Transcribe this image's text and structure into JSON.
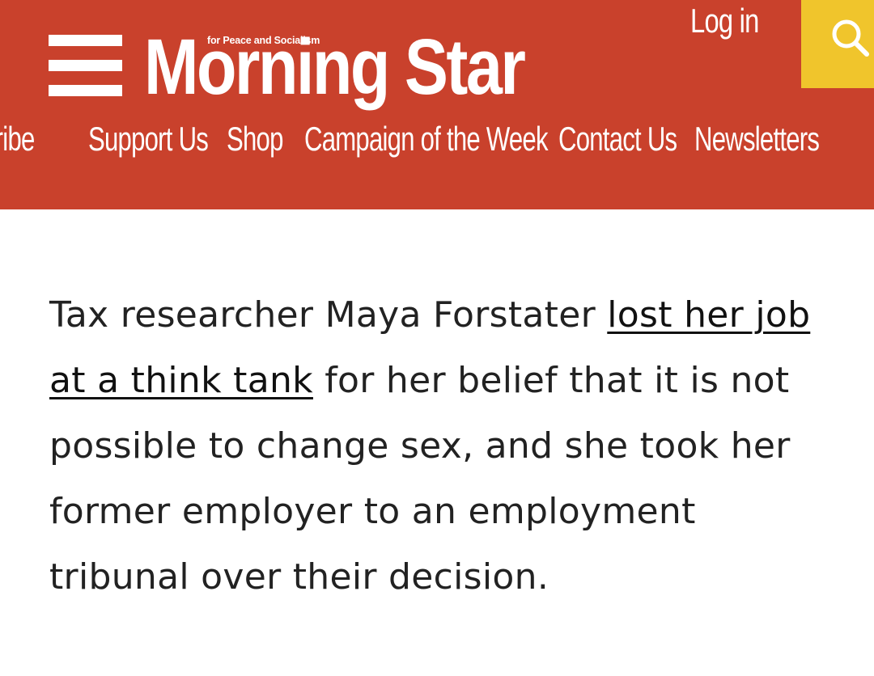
{
  "header": {
    "logo": {
      "tagline": "for Peace and Socialism",
      "name": "Morning Star"
    },
    "login_label": "Log in",
    "colors": {
      "background": "#c9412c",
      "search_background": "#f0c52c",
      "text": "#ffffff"
    },
    "icons": {
      "menu": "hamburger-menu-icon",
      "search": "search-icon"
    }
  },
  "nav": {
    "items": [
      {
        "label": "Subscribe"
      },
      {
        "label": "Support Us"
      },
      {
        "label": "Shop"
      },
      {
        "label": "Campaign of the Week"
      },
      {
        "label": "Contact Us"
      },
      {
        "label": "Newsletters"
      }
    ]
  },
  "article": {
    "text_before": "Tax researcher Maya Forstater ",
    "link_text": "lost her job at a think tank",
    "text_after": " for her belief that it is not possible to change sex, and she took her former employer to an employment tribunal over their decision."
  }
}
